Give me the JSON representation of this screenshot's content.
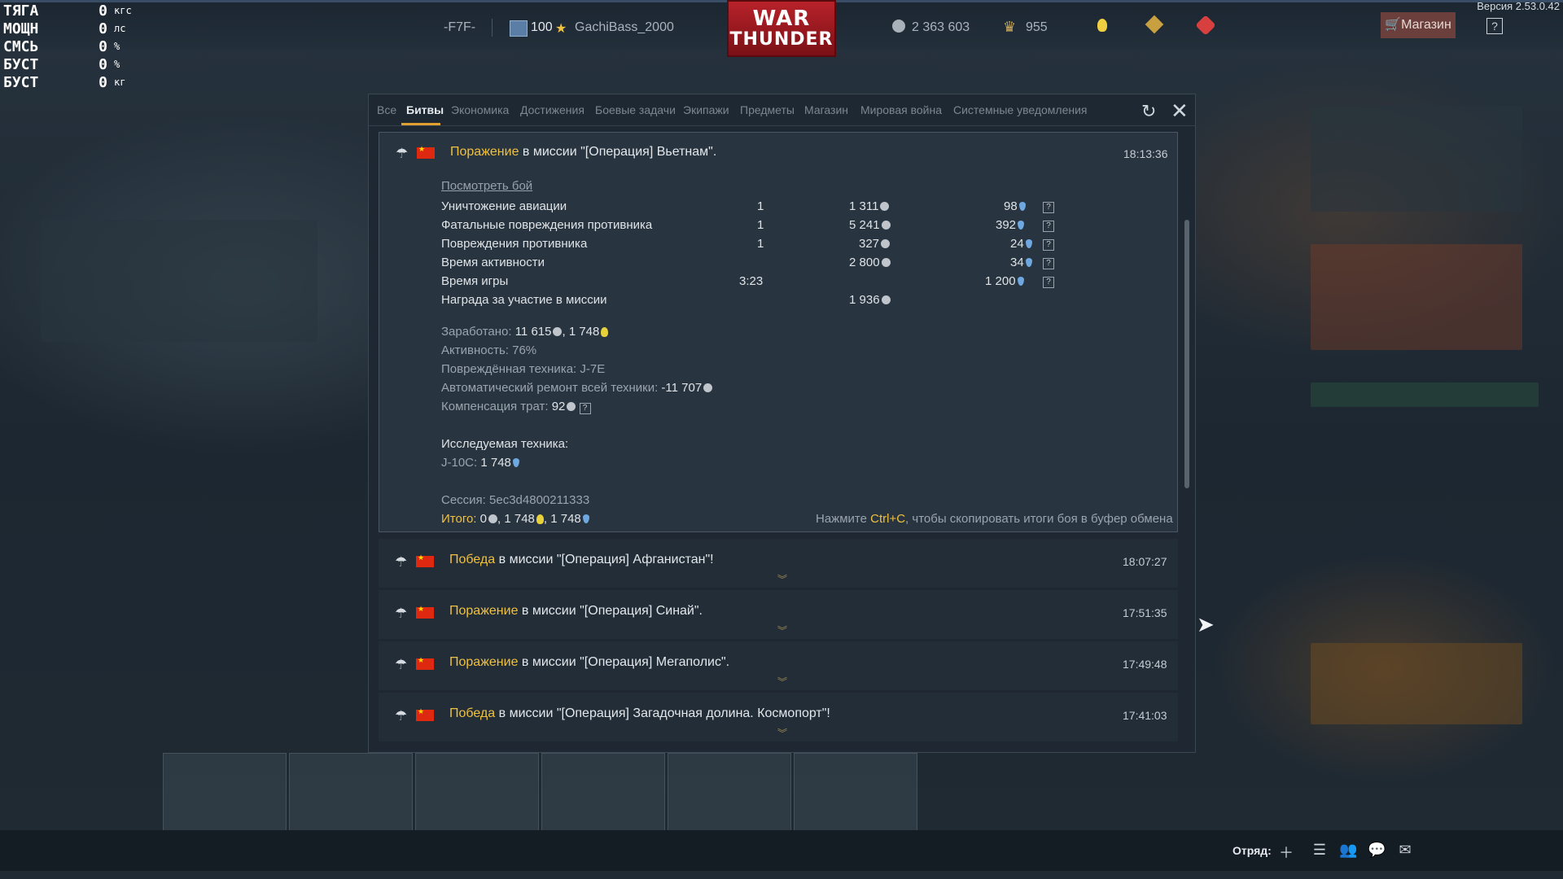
{
  "hud": [
    {
      "label": "ТЯГА",
      "value": "0",
      "unit": "кгс"
    },
    {
      "label": "МОЩН",
      "value": "0",
      "unit": "лс"
    },
    {
      "label": "СМСЬ",
      "value": "0",
      "unit": "%"
    },
    {
      "label": "БУСТ",
      "value": "0",
      "unit": "%"
    },
    {
      "label": "БУСТ",
      "value": "0",
      "unit": "кг"
    }
  ],
  "topbar": {
    "squad_tag": "-F7F-",
    "level": "100",
    "nickname": "GachiBass_2000",
    "logo_line1": "WAR",
    "logo_line2": "THUNDER",
    "silver_lions": "2 363 603",
    "golden_eagles": "955",
    "shop_label": "Магазин",
    "help_label": "?",
    "version": "Версия 2.53.0.42"
  },
  "tabs": [
    "Все",
    "Битвы",
    "Экономика",
    "Достижения",
    "Боевые задачи",
    "Экипажи",
    "Предметы",
    "Магазин",
    "Мировая война",
    "Системные уведомления"
  ],
  "active_tab": "Битвы",
  "expanded_message": {
    "result": "Поражение",
    "title_rest": " в миссии \"[Операция] Вьетнам\".",
    "time": "18:13:36",
    "view_battle": "Посмотреть бой",
    "rows": [
      {
        "name": "Уничтожение авиации",
        "count": "1",
        "lions": "1 311",
        "rp": "98",
        "help": true
      },
      {
        "name": "Фатальные повреждения противника",
        "count": "1",
        "lions": "5 241",
        "rp": "392",
        "help": true
      },
      {
        "name": "Повреждения противника",
        "count": "1",
        "lions": "327",
        "rp": "24",
        "help": true
      },
      {
        "name": "Время активности",
        "count": "",
        "lions": "2 800",
        "rp": "34",
        "help": true
      },
      {
        "name": "Время игры",
        "count": "3:23",
        "lions": "",
        "rp": "1 200",
        "help": true
      },
      {
        "name": "Награда за участие в миссии",
        "count": "",
        "lions": "1 936",
        "rp": "",
        "help": false
      }
    ],
    "earned_label": "Заработано: ",
    "earned_lions": "11 615",
    "earned_rp": "1 748",
    "activity": "Активность: 76%",
    "damaged": "Повреждённая техника: J-7E",
    "repair_label": "Автоматический ремонт всей техники: ",
    "repair_value": "-11 707",
    "compensation_label": "Компенсация трат: ",
    "compensation_value": "92",
    "research_label": "Исследуемая техника:",
    "research_vehicle": "J-10C: ",
    "research_value": "1 748",
    "session": "Сессия: 5ec3d4800211333",
    "total_label": "Итого: ",
    "total_lions": "0",
    "total_rp1": "1 748",
    "total_rp2": "1 748",
    "hint_pre": "Нажмите ",
    "hint_key": "Ctrl+C",
    "hint_post": ", чтобы скопировать итоги боя в буфер обмена"
  },
  "messages": [
    {
      "result": "Победа",
      "rest": " в миссии \"[Операция] Афганистан\"!",
      "time": "18:07:27"
    },
    {
      "result": "Поражение",
      "rest": " в миссии \"[Операция] Синай\".",
      "time": "17:51:35"
    },
    {
      "result": "Поражение",
      "rest": " в миссии \"[Операция] Мегаполис\".",
      "time": "17:49:48"
    },
    {
      "result": "Победа",
      "rest": " в миссии \"[Операция] Загадочная долина. Космопорт\"!",
      "time": "17:41:03"
    }
  ],
  "bottombar": {
    "squad_label": "Отряд:"
  },
  "colors": {
    "accent": "#f0c040",
    "shop": "#6b3f3b",
    "logo": "#b8222a"
  }
}
